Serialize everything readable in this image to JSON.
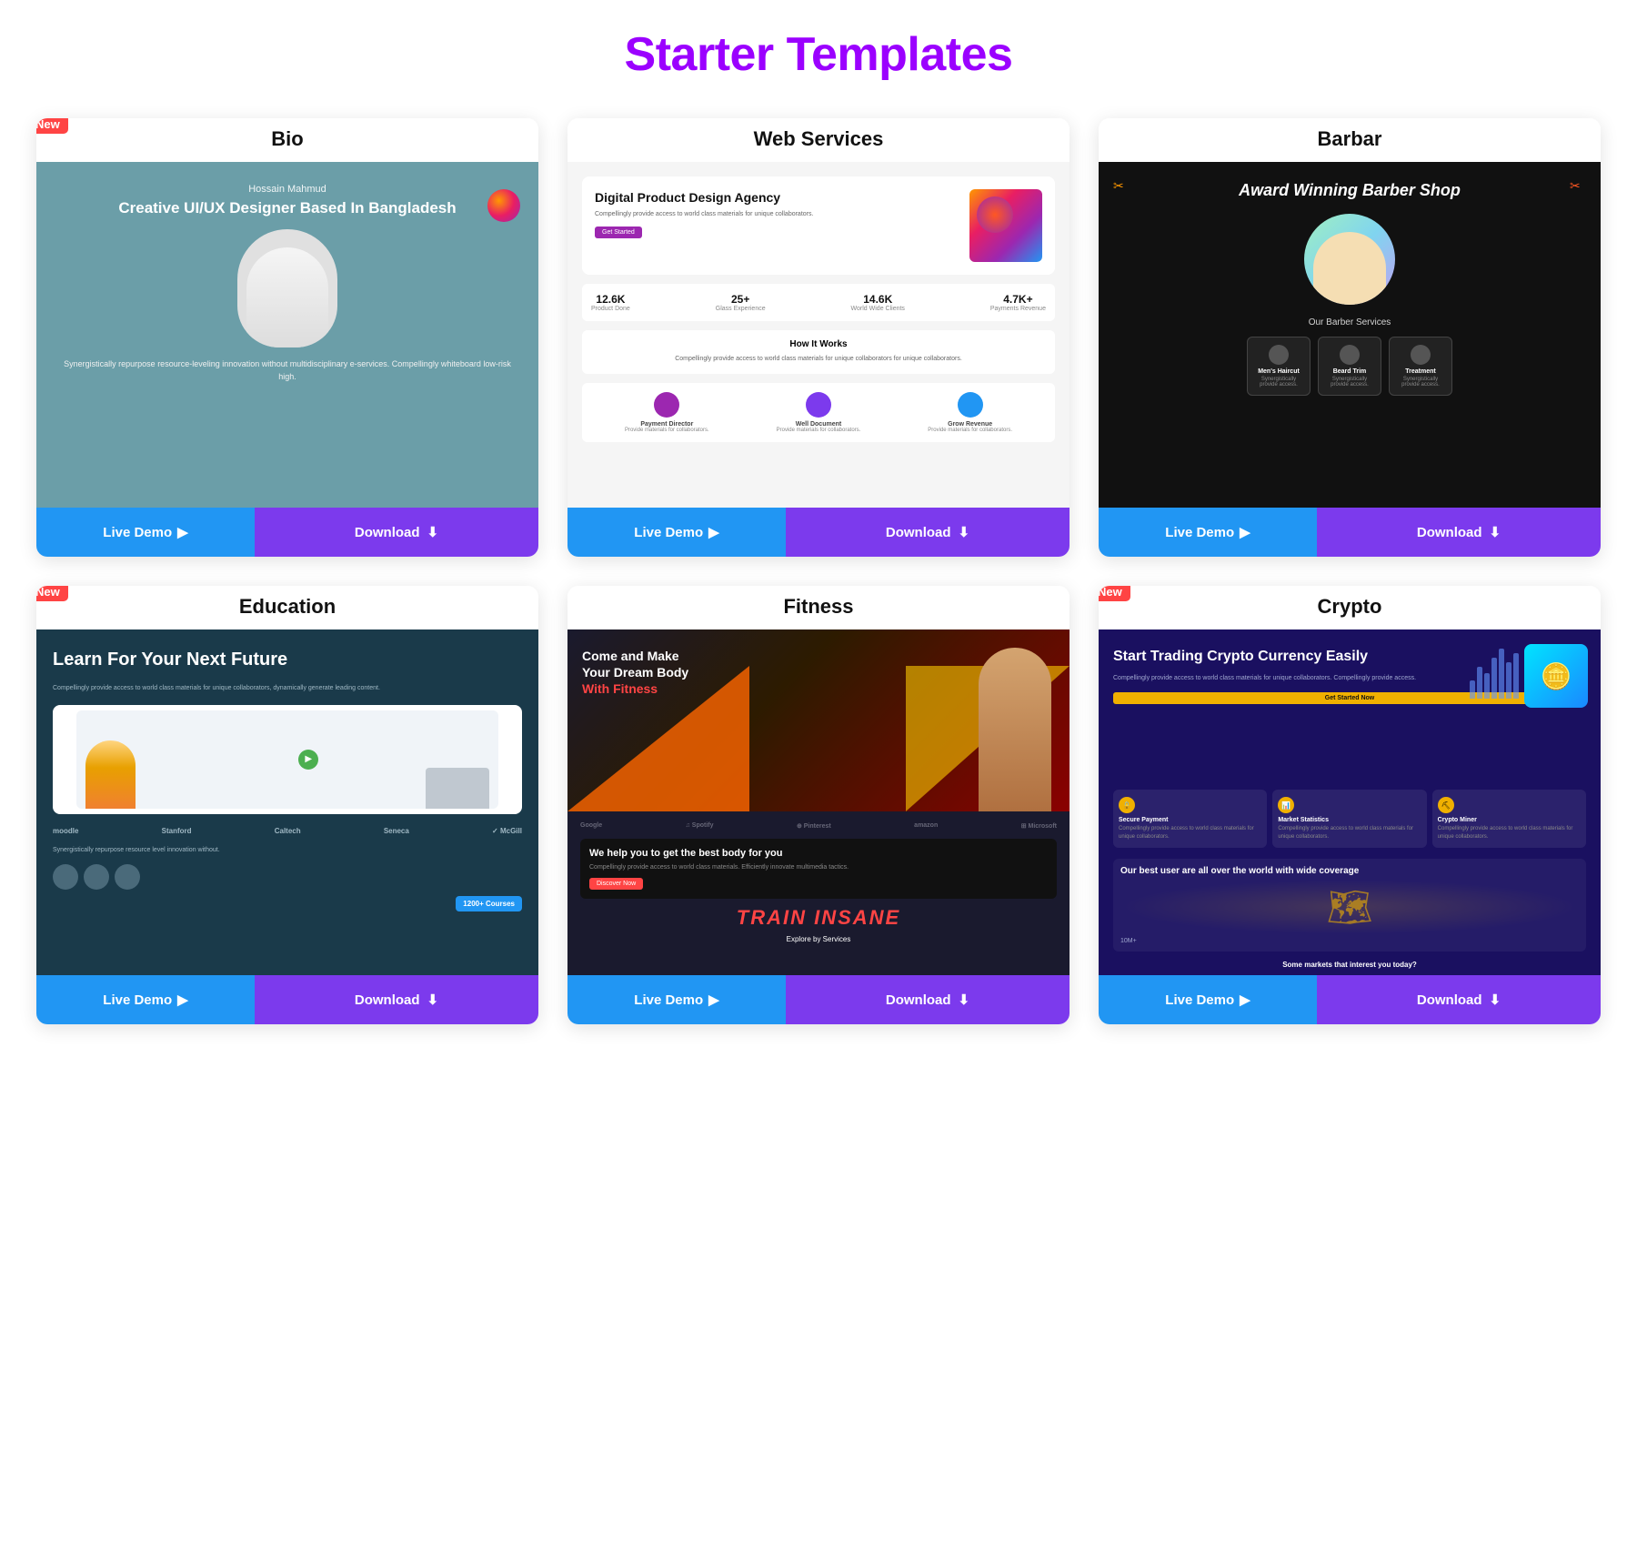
{
  "page": {
    "title": "Starter Templates"
  },
  "cards": [
    {
      "id": "bio",
      "title": "Bio",
      "isNew": true,
      "liveDemoLabel": "Live Demo",
      "downloadLabel": "Download"
    },
    {
      "id": "web-services",
      "title": "Web Services",
      "isNew": false,
      "liveDemoLabel": "Live Demo",
      "downloadLabel": "Download"
    },
    {
      "id": "barbar",
      "title": "Barbar",
      "isNew": false,
      "liveDemoLabel": "Live Demo",
      "downloadLabel": "Download"
    },
    {
      "id": "education",
      "title": "Education",
      "isNew": true,
      "liveDemoLabel": "Live Demo",
      "downloadLabel": "Download"
    },
    {
      "id": "fitness",
      "title": "Fitness",
      "isNew": false,
      "liveDemoLabel": "Live Demo",
      "downloadLabel": "Download"
    },
    {
      "id": "crypto",
      "title": "Crypto",
      "isNew": true,
      "liveDemoLabel": "Live Demo",
      "downloadLabel": "Download"
    }
  ],
  "bio": {
    "personName": "Hossain Mahmud",
    "heroTitle": "Creative UI/UX Designer Based In Bangladesh",
    "description": "Synergistically repurpose resource-leveling innovation without multidisciplinary e-services. Compellingly whiteboard low-risk high.",
    "newBadge": "New"
  },
  "webServices": {
    "heroTitle": "Digital Product Design Agency",
    "stat1Num": "12.6K",
    "stat1Label": "Product Done",
    "stat2Num": "25+",
    "stat2Label": "Glass Experience",
    "stat3Num": "14.6K",
    "stat3Label": "World Wide Clients",
    "stat4Num": "4.7K+",
    "stat4Label": "Payments Revenue",
    "howItWorks": "How It Works",
    "icon1Label": "Payment Director",
    "icon2Label": "Well Document",
    "icon3Label": "Grow Revenue"
  },
  "barbar": {
    "heroTitle": "Award Winning Barber Shop",
    "servicesTitle": "Our Barber Services",
    "service1": "Men's Haircut",
    "service2": "Beard Trim",
    "service3": "Treatment"
  },
  "education": {
    "heroTitle": "Learn For Your Next Future",
    "desc": "Compellingly provide access to world class materials for unique collaborators, dynamically generate leading content.",
    "logos": [
      "moodle",
      "Stanford",
      "Caltech",
      "Seneca",
      "McGill"
    ],
    "countLabel": "1200+ Courses",
    "desc2": "Synergistically repurpose resource level innovation without."
  },
  "fitness": {
    "heroTitle": "Come and Make Your Dream Body With Fitness",
    "titleAccent": "With Fitness",
    "sectionTitle": "We help you to get the best body for you",
    "exploreLabel": "Explore by Services",
    "insane": "TRAIN INSANE",
    "brands": [
      "Google",
      "Spotify",
      "Pinterest",
      "amazon",
      "Microsoft"
    ]
  },
  "crypto": {
    "heroTitle": "Start Trading Crypto Currency Easily",
    "desc": "Compellingly provide access to world class materials for unique collaborators. Compellingly provide access.",
    "ctaLabel": "Get Started Now",
    "card1Title": "Secure Payment",
    "card2Title": "Market Statistics",
    "card3Title": "Crypto Miner",
    "mapTitle": "Our best user are all over the world with wide coverage",
    "mapSub": "10M+",
    "bottomText": "Some markets that interest you today?"
  }
}
